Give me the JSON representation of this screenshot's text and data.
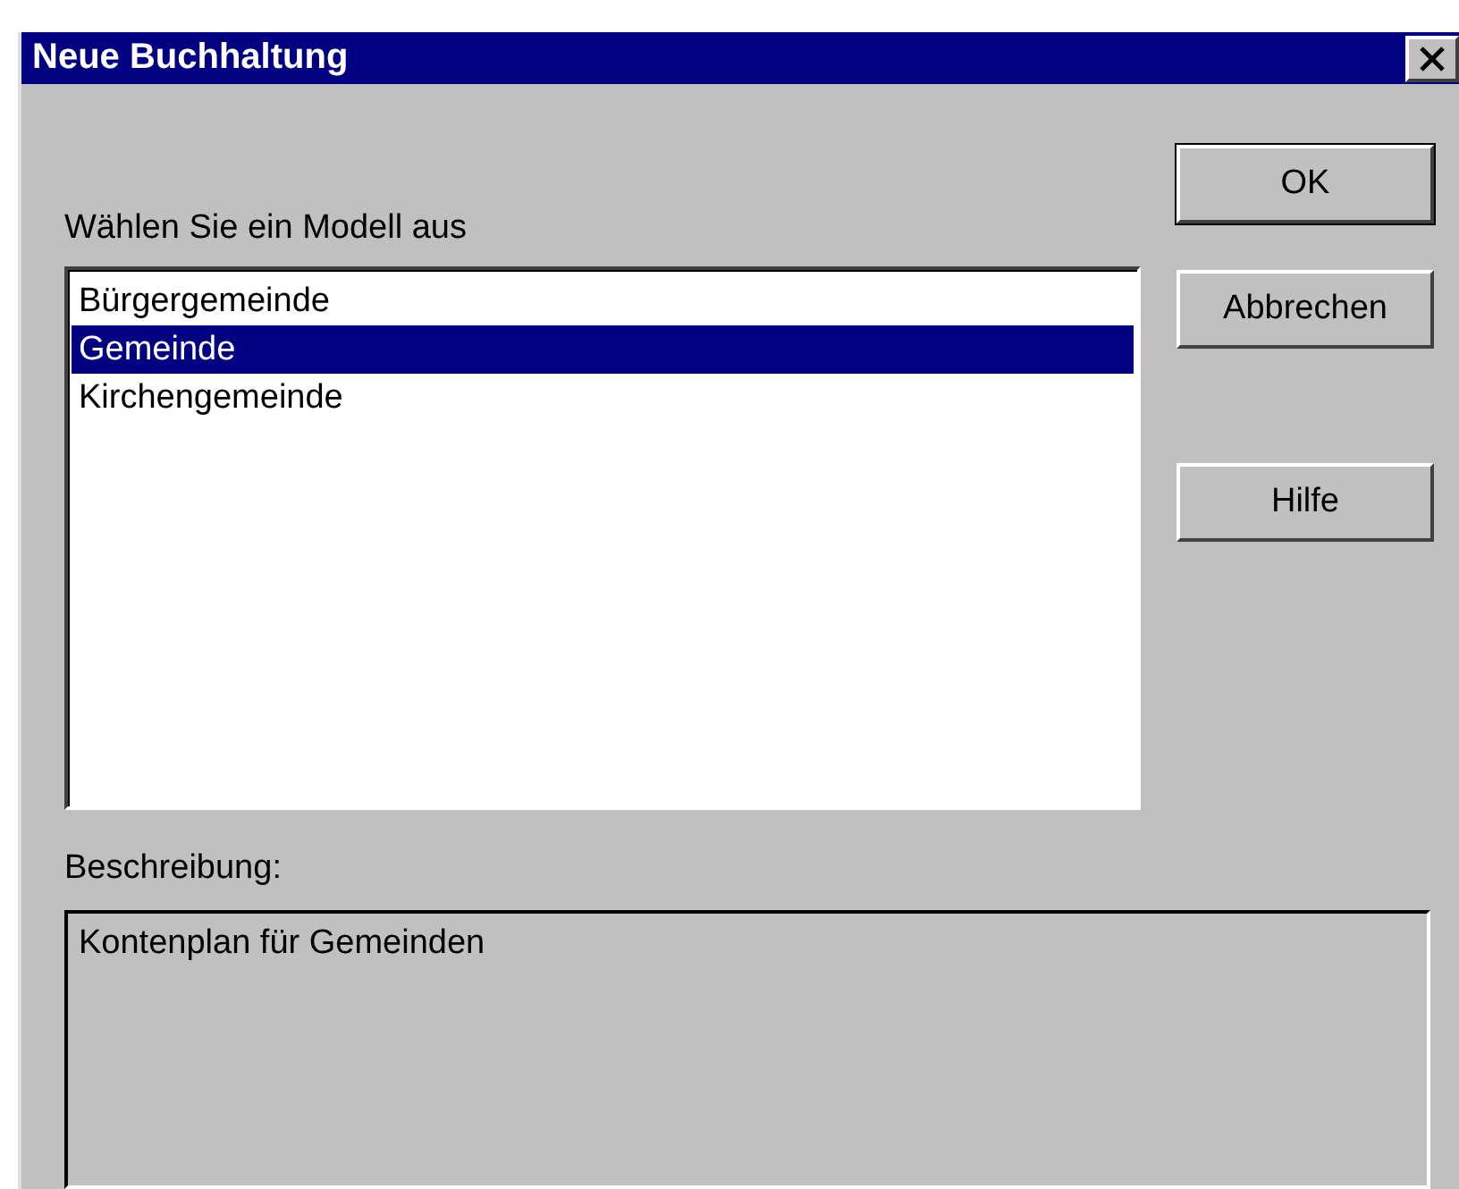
{
  "window": {
    "title": "Neue Buchhaltung"
  },
  "list_label": "Wählen Sie ein Modell aus",
  "models": [
    {
      "label": "Bürgergemeinde",
      "selected": false
    },
    {
      "label": "Gemeinde",
      "selected": true
    },
    {
      "label": "Kirchengemeinde",
      "selected": false
    }
  ],
  "buttons": [
    {
      "label": "OK",
      "default": true
    },
    {
      "label": "Abbrechen",
      "default": false
    },
    {
      "label": "Hilfe",
      "default": false
    }
  ],
  "description_label": "Beschreibung:",
  "description": "Kontenplan für Gemeinden"
}
